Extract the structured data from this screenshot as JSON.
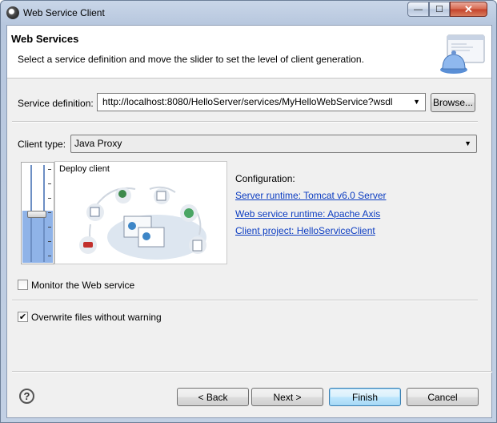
{
  "window": {
    "title": "Web Service Client",
    "minimize_glyph": "—",
    "maximize_glyph": "☐",
    "close_glyph": "✕"
  },
  "header": {
    "title": "Web Services",
    "description": "Select a service definition and move the slider to set the level of client generation.",
    "banner_icon": "web-service-bell-icon"
  },
  "service_definition": {
    "label": "Service definition:",
    "value": "http://localhost:8080/HelloServer/services/MyHelloWebService?wsdl",
    "browse_label": "Browse..."
  },
  "client_type": {
    "label": "Client type:",
    "value": "Java Proxy"
  },
  "slider": {
    "level_label": "Deploy client",
    "level_fraction": 0.5
  },
  "configuration": {
    "label": "Configuration:",
    "server_runtime": "Server runtime: Tomcat v6.0 Server",
    "web_service_runtime": "Web service runtime: Apache Axis",
    "client_project": "Client project: HelloServiceClient"
  },
  "options": {
    "monitor_label": "Monitor the Web service",
    "monitor_checked": false,
    "overwrite_label": "Overwrite files without warning",
    "overwrite_checked": true,
    "check_glyph": "✔"
  },
  "buttons": {
    "help_glyph": "?",
    "back": "< Back",
    "next": "Next >",
    "finish": "Finish",
    "cancel": "Cancel"
  },
  "colors": {
    "link": "#0b3cc1",
    "slider_fill": "#8fb3e8",
    "finish_border": "#3c7fb1"
  }
}
